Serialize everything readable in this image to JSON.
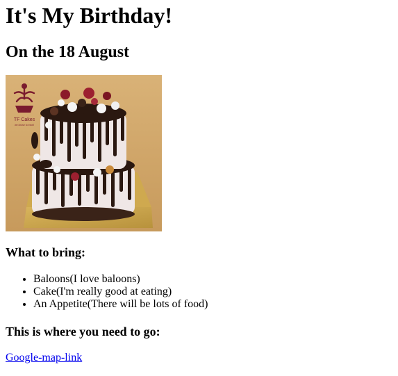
{
  "page": {
    "title": "It's My Birthday!",
    "subtitle": "On the 18 August"
  },
  "image": {
    "logo_text": "TF Cakes",
    "logo_tagline": "we chose to excel"
  },
  "bring": {
    "heading": "What to bring:",
    "items": [
      {
        "label": "Baloons(I love baloons)"
      },
      {
        "label": "Cake(I'm really good at eating)"
      },
      {
        "label": "An Appetite(There will be lots of food)"
      }
    ]
  },
  "location": {
    "heading": "This is where you need to go:",
    "link_text": "Google-map-link"
  },
  "colors": {
    "link": "#0000ee",
    "text": "#000000",
    "background": "#ffffff",
    "image_backdrop": "#d9b277",
    "cake_board": "#caa650",
    "chocolate": "#2a1810",
    "frosting": "#efe7e6"
  }
}
